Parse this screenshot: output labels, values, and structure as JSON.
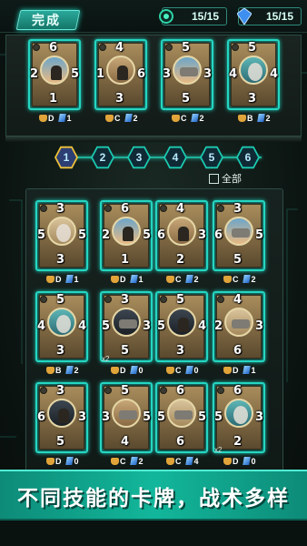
{
  "header": {
    "done_label": "完成",
    "energy_value": "15/15",
    "gem_value": "15/15"
  },
  "deck": [
    {
      "stats": {
        "top": "6",
        "left": "2",
        "right": "5",
        "bottom": "1"
      },
      "rank": "D",
      "cost": "1",
      "portrait": "p-sky",
      "figure": "fig"
    },
    {
      "stats": {
        "top": "4",
        "left": "1",
        "right": "6",
        "bottom": "3"
      },
      "rank": "C",
      "cost": "2",
      "portrait": "p-tan",
      "figure": "fig"
    },
    {
      "stats": {
        "top": "5",
        "left": "3",
        "right": "3",
        "bottom": "5"
      },
      "rank": "C",
      "cost": "2",
      "portrait": "p-sky",
      "figure": "fig2"
    },
    {
      "stats": {
        "top": "5",
        "left": "4",
        "right": "4",
        "bottom": "3"
      },
      "rank": "B",
      "cost": "2",
      "portrait": "p-teal",
      "figure": "fig3"
    }
  ],
  "pages": [
    "1",
    "2",
    "3",
    "4",
    "5",
    "6"
  ],
  "filter": {
    "all_label": "全部"
  },
  "collection": [
    {
      "stats": {
        "top": "3",
        "left": "5",
        "right": "5",
        "bottom": "3"
      },
      "rank": "D",
      "cost": "1",
      "portrait": "p-sand",
      "figure": "fig3",
      "mult": ""
    },
    {
      "stats": {
        "top": "6",
        "left": "2",
        "right": "5",
        "bottom": "1"
      },
      "rank": "D",
      "cost": "1",
      "portrait": "p-sky",
      "figure": "fig",
      "mult": ""
    },
    {
      "stats": {
        "top": "4",
        "left": "6",
        "right": "3",
        "bottom": "2"
      },
      "rank": "C",
      "cost": "2",
      "portrait": "p-tan",
      "figure": "fig",
      "mult": ""
    },
    {
      "stats": {
        "top": "3",
        "left": "6",
        "right": "5",
        "bottom": "5"
      },
      "rank": "C",
      "cost": "2",
      "portrait": "p-sky",
      "figure": "fig2",
      "mult": ""
    },
    {
      "stats": {
        "top": "5",
        "left": "4",
        "right": "4",
        "bottom": "3"
      },
      "rank": "B",
      "cost": "2",
      "portrait": "p-teal",
      "figure": "fig3",
      "mult": ""
    },
    {
      "stats": {
        "top": "3",
        "left": "5",
        "right": "3",
        "bottom": "5"
      },
      "rank": "D",
      "cost": "0",
      "portrait": "p-dark",
      "figure": "fig2",
      "mult": "x2"
    },
    {
      "stats": {
        "top": "5",
        "left": "5",
        "right": "4",
        "bottom": "3"
      },
      "rank": "C",
      "cost": "0",
      "portrait": "p-dark",
      "figure": "fig",
      "mult": ""
    },
    {
      "stats": {
        "top": "4",
        "left": "2",
        "right": "3",
        "bottom": "6"
      },
      "rank": "D",
      "cost": "1",
      "portrait": "p-sand",
      "figure": "fig2",
      "mult": ""
    },
    {
      "stats": {
        "top": "3",
        "left": "6",
        "right": "3",
        "bottom": "5"
      },
      "rank": "D",
      "cost": "0",
      "portrait": "p-dark",
      "figure": "fig",
      "mult": ""
    },
    {
      "stats": {
        "top": "5",
        "left": "3",
        "right": "5",
        "bottom": "4"
      },
      "rank": "C",
      "cost": "2",
      "portrait": "p-tan",
      "figure": "fig2",
      "mult": ""
    },
    {
      "stats": {
        "top": "6",
        "left": "5",
        "right": "5",
        "bottom": "6"
      },
      "rank": "C",
      "cost": "4",
      "portrait": "p-sand",
      "figure": "fig2",
      "mult": ""
    },
    {
      "stats": {
        "top": "6",
        "left": "5",
        "right": "3",
        "bottom": "2"
      },
      "rank": "D",
      "cost": "0",
      "portrait": "p-teal",
      "figure": "fig3",
      "mult": "x2"
    }
  ],
  "banner": {
    "text": "不同技能的卡牌，战术多样"
  }
}
